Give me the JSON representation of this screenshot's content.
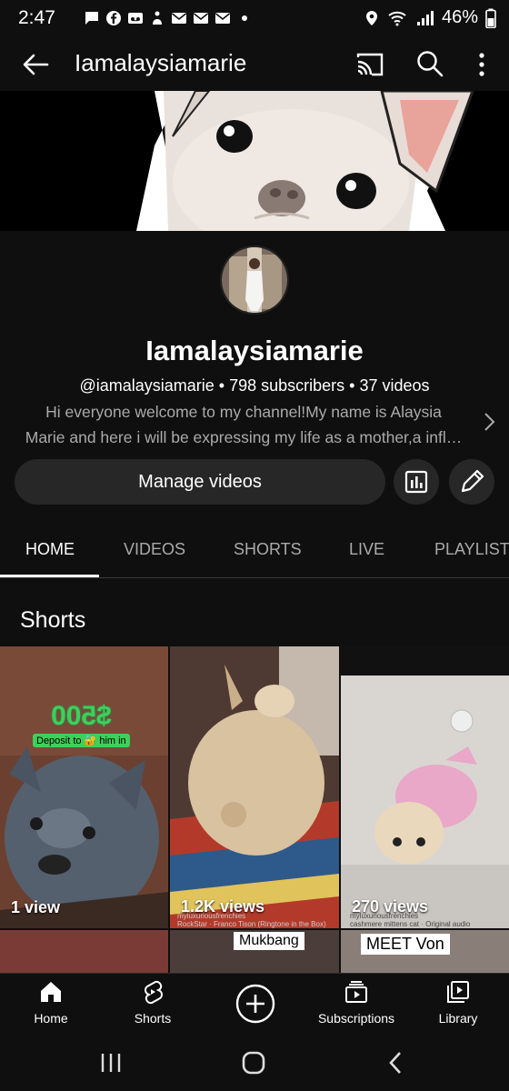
{
  "status_bar": {
    "time": "2:47",
    "battery": "46%",
    "left_icons": [
      "message-icon",
      "facebook-icon",
      "voicemail-icon",
      "app-icon",
      "mail-icon",
      "mail-icon",
      "mail-icon",
      "dot-icon"
    ],
    "right_icons": [
      "location-icon",
      "wifi-icon",
      "signal-icon",
      "battery-icon"
    ]
  },
  "app_bar": {
    "title": "Iamalaysiamarie",
    "icons": [
      "back-arrow-icon",
      "cast-icon",
      "search-icon",
      "more-vert-icon"
    ]
  },
  "channel": {
    "name": "Iamalaysiamarie",
    "meta": "@iamalaysiamarie • 798 subscribers • 37 videos",
    "description_line1": "Hi everyone welcome to my channel!My name is Alaysia",
    "description_line2": "Marie and here i will be expressing my life as a mother,a infl…",
    "manage_label": "Manage videos"
  },
  "tabs": [
    {
      "label": "HOME",
      "active": true
    },
    {
      "label": "VIDEOS",
      "active": false
    },
    {
      "label": "SHORTS",
      "active": false
    },
    {
      "label": "LIVE",
      "active": false
    },
    {
      "label": "PLAYLIST",
      "active": false
    }
  ],
  "shorts": {
    "title": "Shorts",
    "items": [
      {
        "views": "1 view",
        "overlay_big": "$500",
        "overlay_small": "Deposit to 🔐 him in"
      },
      {
        "views": "1.2K views",
        "credit_line1": "myluxuriousfrenchies",
        "credit_line2": "RockStar · Franco Tison (Ringtone in the Box)"
      },
      {
        "views": "270 views",
        "credit_line1": "myluxuriousfrenchies",
        "credit_line2": "cashmere mittens cat · Original audio"
      }
    ],
    "row2_captions": [
      "Mukbang",
      "MEET Von"
    ]
  },
  "bottom_nav": [
    {
      "label": "Home",
      "icon": "home-icon"
    },
    {
      "label": "Shorts",
      "icon": "shorts-icon"
    },
    {
      "label": "",
      "icon": "create-icon"
    },
    {
      "label": "Subscriptions",
      "icon": "subscriptions-icon"
    },
    {
      "label": "Library",
      "icon": "library-icon"
    }
  ],
  "colors": {
    "background": "#0f0f0f",
    "surface": "#272727",
    "text": "#f1f1f1",
    "muted": "#aaaaaa",
    "green": "#3fcf5a"
  }
}
